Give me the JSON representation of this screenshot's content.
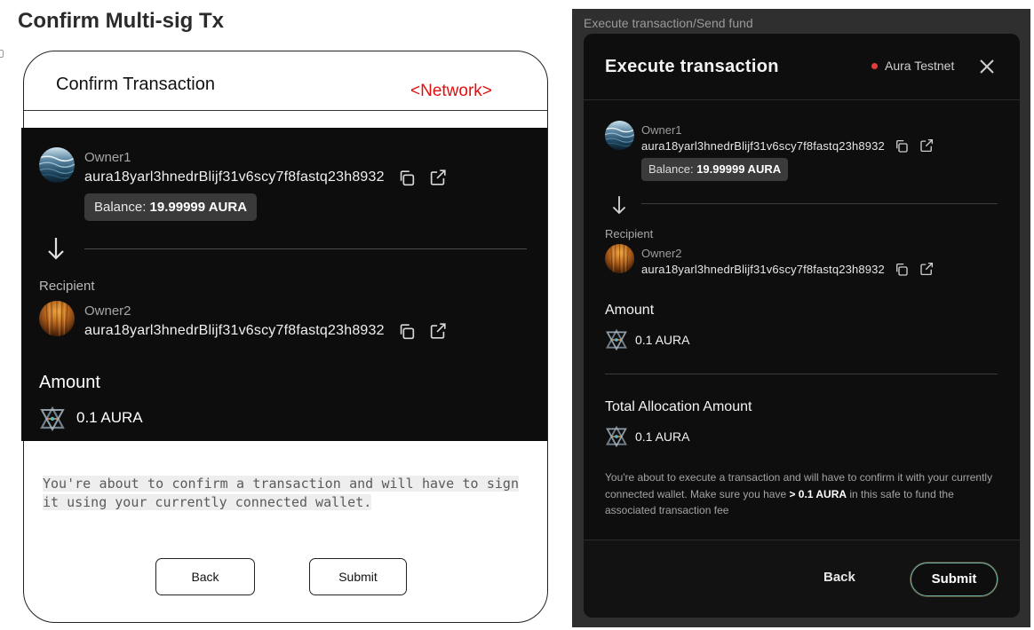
{
  "page": {
    "title": "Confirm Multi-sig Tx"
  },
  "wireframe": {
    "header_title": "Confirm Transaction",
    "network_placeholder": "<Network>",
    "sender": {
      "name": "Owner1",
      "address": "aura18yarl3hnedrBlijf31v6scy7f8fastq23h8932",
      "balance_label": "Balance: ",
      "balance_value": "19.99999 AURA"
    },
    "recipient_label": "Recipient",
    "recipient": {
      "name": "Owner2",
      "address": "aura18yarl3hnedrBlijf31v6scy7f8fastq23h8932"
    },
    "amount_label": "Amount",
    "amount_value": "0.1 AURA",
    "note": "You're about to confirm a transaction and will have to sign it using your currently connected wallet.",
    "back_label": "Back",
    "submit_label": "Submit"
  },
  "mockup": {
    "caption": "Execute transaction/Send fund",
    "title": "Execute transaction",
    "network": "Aura Testnet",
    "sender": {
      "name": "Owner1",
      "address": "aura18yarl3hnedrBlijf31v6scy7f8fastq23h8932",
      "balance_label": "Balance: ",
      "balance_value": "19.99999 AURA"
    },
    "recipient_label": "Recipient",
    "recipient": {
      "name": "Owner2",
      "address": "aura18yarl3hnedrBlijf31v6scy7f8fastq23h8932"
    },
    "amount_label": "Amount",
    "amount_value": "0.1 AURA",
    "total_label": "Total Allocation Amount",
    "total_value": "0.1 AURA",
    "note_prefix": "You're about to execute a transaction and will have to confirm it with your currently connected wallet. Make sure you have ",
    "note_bold": "> 0.1 AURA",
    "note_suffix": " in this safe to fund the associated transaction fee",
    "back_label": "Back",
    "submit_label": "Submit"
  },
  "colors": {
    "dark_panel": "#0d0d0d",
    "network_text": "#e01010",
    "status_dot": "#e53b3b",
    "submit_border": "#6fb3a4"
  },
  "icons": [
    "copy-icon",
    "external-link-icon",
    "arrow-down-icon",
    "close-icon",
    "aura-token-icon",
    "avatar-owner1",
    "avatar-owner2"
  ]
}
